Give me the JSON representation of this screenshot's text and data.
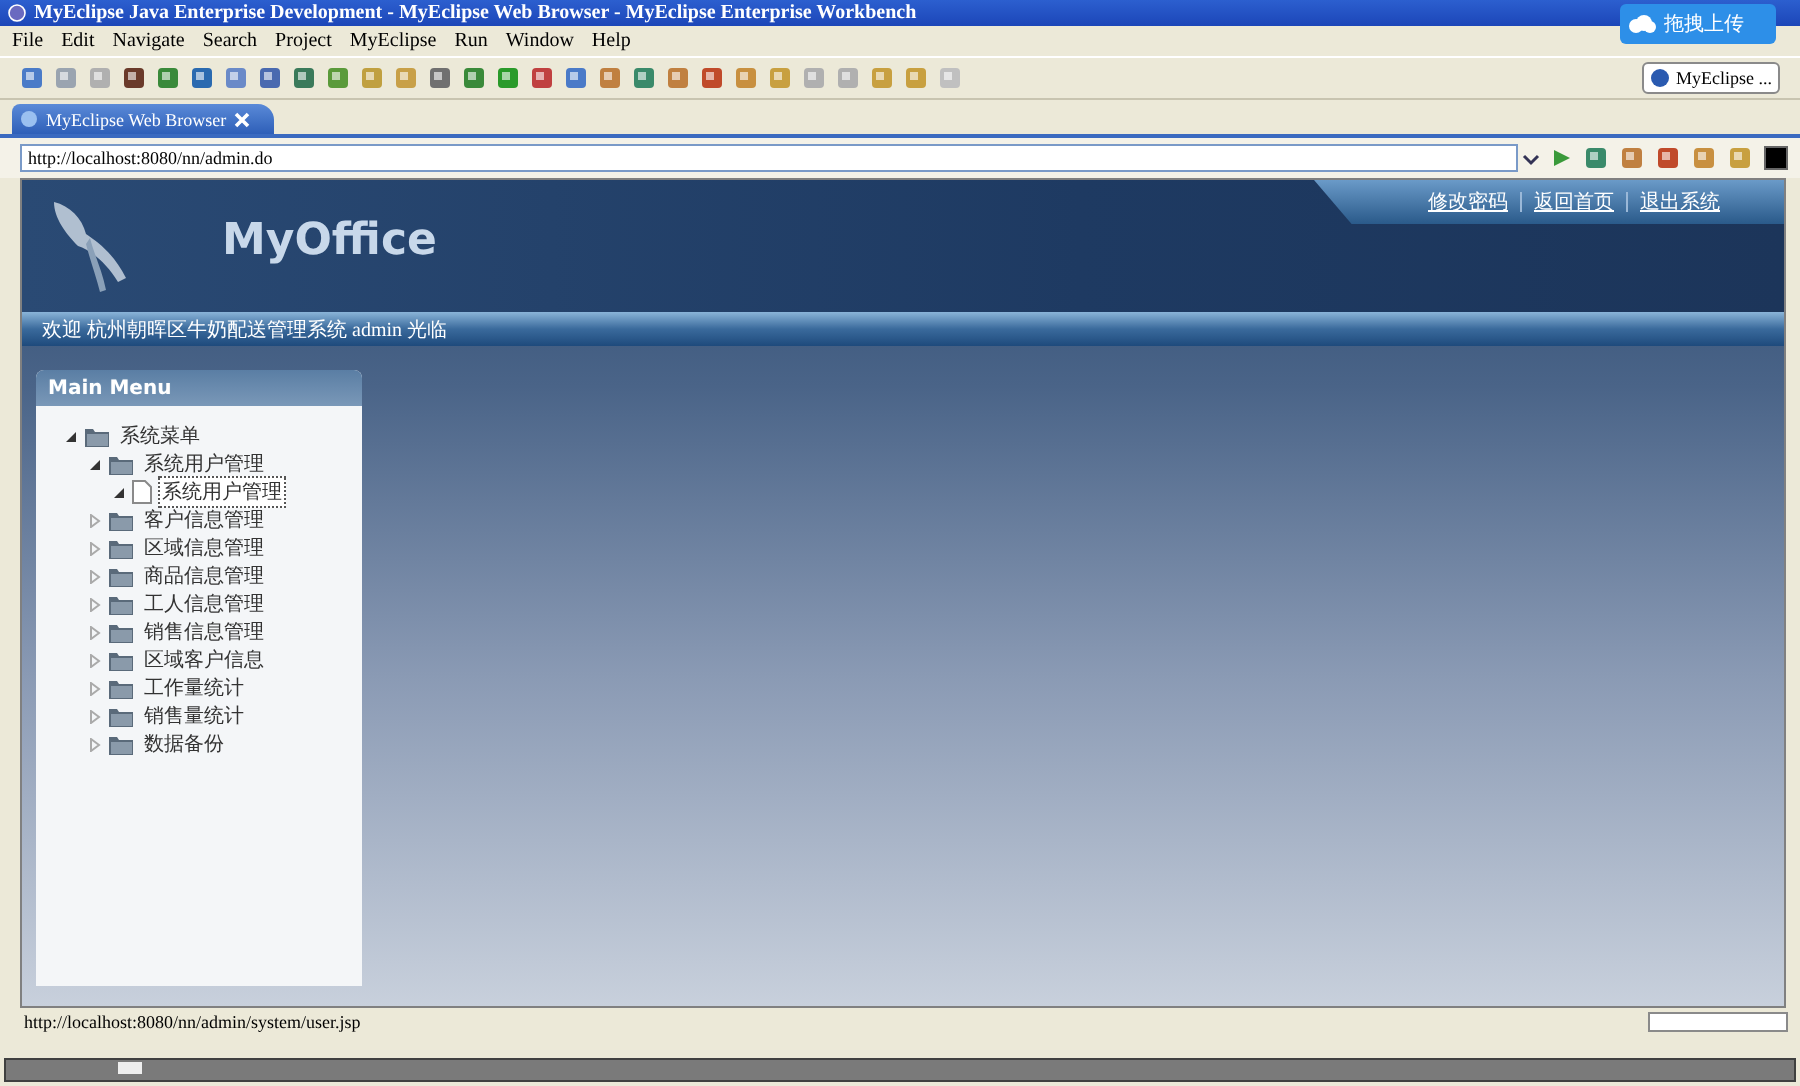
{
  "window": {
    "title": "MyEclipse Java Enterprise Development - MyEclipse Web Browser - MyEclipse Enterprise Workbench"
  },
  "upload_widget": {
    "label": "拖拽上传"
  },
  "menu_bar": [
    "File",
    "Edit",
    "Navigate",
    "Search",
    "Project",
    "MyEclipse",
    "Run",
    "Window",
    "Help"
  ],
  "perspective": {
    "label": "MyEclipse ..."
  },
  "editor_tab": {
    "label": "MyEclipse Web Browser"
  },
  "address_bar": {
    "value": "http://localhost:8080/nn/admin.do"
  },
  "page": {
    "logo": "MyOffice",
    "header_links": [
      "修改密码",
      "返回首页",
      "退出系统"
    ],
    "welcome": "欢迎 杭州朝晖区牛奶配送管理系统 admin 光临",
    "menu": {
      "title": "Main Menu",
      "tree": [
        {
          "label": "系统菜单",
          "kind": "folder",
          "expanded": true,
          "selected": false,
          "children": [
            {
              "label": "系统用户管理",
              "kind": "folder",
              "expanded": true,
              "selected": false,
              "children": [
                {
                  "label": "系统用户管理",
                  "kind": "page",
                  "expanded": true,
                  "selected": true
                }
              ]
            },
            {
              "label": "客户信息管理",
              "kind": "folder",
              "expanded": false,
              "selected": false
            },
            {
              "label": "区域信息管理",
              "kind": "folder",
              "expanded": false,
              "selected": false
            },
            {
              "label": "商品信息管理",
              "kind": "folder",
              "expanded": false,
              "selected": false
            },
            {
              "label": "工人信息管理",
              "kind": "folder",
              "expanded": false,
              "selected": false
            },
            {
              "label": "销售信息管理",
              "kind": "folder",
              "expanded": false,
              "selected": false
            },
            {
              "label": "区域客户信息",
              "kind": "folder",
              "expanded": false,
              "selected": false
            },
            {
              "label": "工作量统计",
              "kind": "folder",
              "expanded": false,
              "selected": false
            },
            {
              "label": "销售量统计",
              "kind": "folder",
              "expanded": false,
              "selected": false
            },
            {
              "label": "数据备份",
              "kind": "folder",
              "expanded": false,
              "selected": false
            }
          ]
        }
      ]
    }
  },
  "status_bar": {
    "text": "http://localhost:8080/nn/admin/system/user.jsp"
  }
}
